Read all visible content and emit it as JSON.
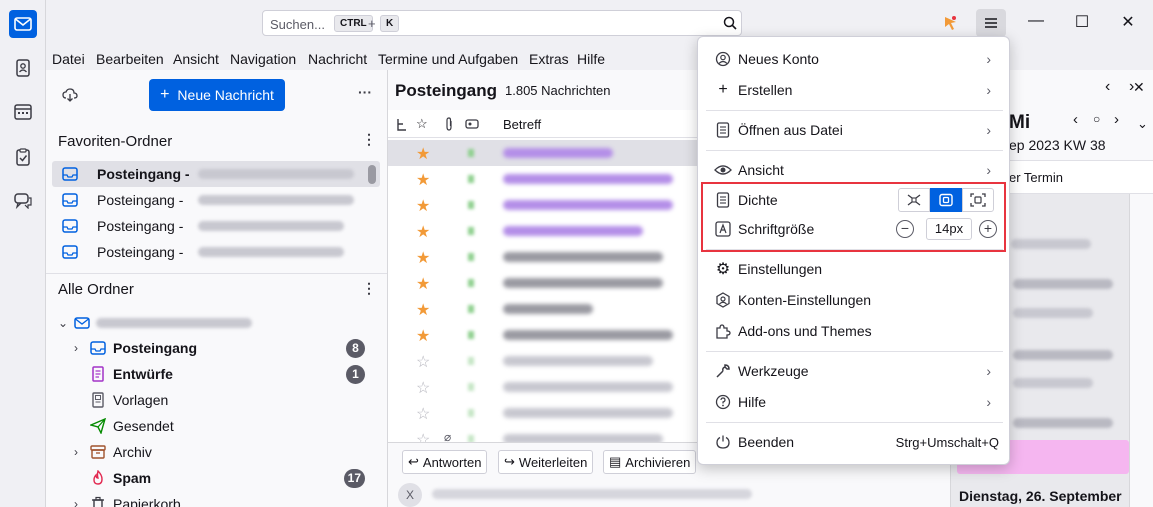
{
  "colors": {
    "accent": "#0061e0",
    "highlight": "#e8343f",
    "star": "#f29a38"
  },
  "search": {
    "placeholder": "Suchen...",
    "kbd1": "CTRL",
    "kbd2": "K"
  },
  "menubar": [
    "Datei",
    "Bearbeiten",
    "Ansicht",
    "Navigation",
    "Nachricht",
    "Termine und Aufgaben",
    "Extras",
    "Hilfe"
  ],
  "folder_pane": {
    "new_message": "Neue Nachricht",
    "favorites_title": "Favoriten-Ordner",
    "favorites": [
      {
        "label": "Posteingang -",
        "bold": true
      },
      {
        "label": "Posteingang -",
        "bold": false
      },
      {
        "label": "Posteingang -",
        "bold": false
      },
      {
        "label": "Posteingang -",
        "bold": false
      }
    ],
    "all_title": "Alle Ordner",
    "folders": [
      {
        "label": "Posteingang",
        "bold": true,
        "count": "8",
        "icon": "inbox-icon"
      },
      {
        "label": "Entwürfe",
        "bold": true,
        "count": "1",
        "icon": "drafts-icon"
      },
      {
        "label": "Vorlagen",
        "bold": false,
        "count": "",
        "icon": "templates-icon"
      },
      {
        "label": "Gesendet",
        "bold": false,
        "count": "",
        "icon": "sent-icon"
      },
      {
        "label": "Archiv",
        "bold": false,
        "count": "",
        "icon": "archive-icon"
      },
      {
        "label": "Spam",
        "bold": true,
        "count": "17",
        "icon": "spam-icon"
      },
      {
        "label": "Papierkorb",
        "bold": false,
        "count": "",
        "icon": "trash-icon"
      }
    ]
  },
  "thread_pane": {
    "title": "Posteingang",
    "count": "1.805 Nachrichten",
    "subject_header": "Betreff",
    "actions": [
      "Antworten",
      "Weiterleiten",
      "Archivieren"
    ],
    "close_label": "X"
  },
  "today_pane": {
    "day": "Mi",
    "date_line": "ep 2023  KW 38",
    "new_event": "er Termin",
    "dates": [
      "Dienstag, 26. September"
    ]
  },
  "app_menu": {
    "items": [
      {
        "label": "Neues Konto",
        "icon": "account-icon",
        "chevron": true
      },
      {
        "label": "Erstellen",
        "icon": "plus-icon",
        "chevron": true
      },
      {
        "label": "Öffnen aus Datei",
        "icon": "file-icon",
        "chevron": true
      },
      {
        "label": "Ansicht",
        "icon": "eye-icon",
        "chevron": true
      },
      {
        "label": "Dichte",
        "icon": "density-icon",
        "chevron": false
      },
      {
        "label": "Schriftgröße",
        "icon": "font-size-icon",
        "chevron": false
      },
      {
        "label": "Einstellungen",
        "icon": "gear-icon",
        "chevron": false
      },
      {
        "label": "Konten-Einstellungen",
        "icon": "account-settings-icon",
        "chevron": false
      },
      {
        "label": "Add-ons und Themes",
        "icon": "puzzle-icon",
        "chevron": false
      },
      {
        "label": "Werkzeuge",
        "icon": "wrench-icon",
        "chevron": true
      },
      {
        "label": "Hilfe",
        "icon": "help-icon",
        "chevron": true
      },
      {
        "label": "Beenden",
        "icon": "power-icon",
        "chevron": false
      }
    ],
    "quit_shortcut": "Strg+Umschalt+Q",
    "font_size": "14px"
  }
}
